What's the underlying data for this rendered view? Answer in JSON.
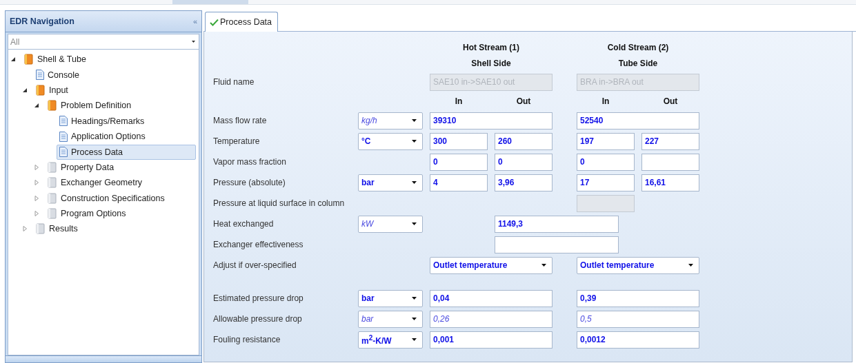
{
  "navigation": {
    "title": "EDR Navigation",
    "collapse_glyph": "«",
    "filter": {
      "value": "All"
    },
    "tree": [
      {
        "label": "Shell & Tube",
        "kind": "group",
        "complete": true,
        "expanded": true,
        "selected": false,
        "children": [
          {
            "label": "Console",
            "kind": "page",
            "selected": false
          },
          {
            "label": "Input",
            "kind": "group",
            "complete": true,
            "expanded": true,
            "selected": false,
            "children": [
              {
                "label": "Problem Definition",
                "kind": "group",
                "complete": true,
                "expanded": true,
                "selected": false,
                "children": [
                  {
                    "label": "Headings/Remarks",
                    "kind": "page",
                    "selected": false
                  },
                  {
                    "label": "Application Options",
                    "kind": "page",
                    "selected": false
                  },
                  {
                    "label": "Process Data",
                    "kind": "page",
                    "selected": true
                  }
                ]
              },
              {
                "label": "Property Data",
                "kind": "group",
                "complete": false,
                "expanded": false,
                "selected": false
              },
              {
                "label": "Exchanger Geometry",
                "kind": "group",
                "complete": false,
                "expanded": false,
                "selected": false
              },
              {
                "label": "Construction Specifications",
                "kind": "group",
                "complete": false,
                "expanded": false,
                "selected": false
              },
              {
                "label": "Program Options",
                "kind": "group",
                "complete": false,
                "expanded": false,
                "selected": false
              }
            ]
          },
          {
            "label": "Results",
            "kind": "group",
            "complete": false,
            "expanded": false,
            "selected": false
          }
        ]
      }
    ]
  },
  "tabs": [
    {
      "label": "Process Data",
      "selected": true,
      "complete": true
    }
  ],
  "form": {
    "stream_titles": {
      "hot": "Hot Stream (1)",
      "cold": "Cold Stream (2)"
    },
    "sides": {
      "hot": "Shell Side",
      "cold": "Tube Side"
    },
    "rows": [
      {
        "kind": "fields",
        "label": "Fluid name",
        "hot": {
          "value": "SAE10 in->SAE10 out",
          "kind": "disabled"
        },
        "cold": {
          "value": "BRA in->BRA out",
          "kind": "disabled"
        }
      },
      {
        "kind": "io",
        "hot_in": "In",
        "hot_out": "Out",
        "cold_in": "In",
        "cold_out": "Out"
      },
      {
        "kind": "fields",
        "label": "Mass flow rate",
        "unit": {
          "value": "kg/h",
          "kind": "default"
        },
        "hot": {
          "value": "39310",
          "kind": "entered"
        },
        "cold": {
          "value": "52540",
          "kind": "entered"
        }
      },
      {
        "kind": "fields",
        "label": "Temperature",
        "unit": {
          "value": "°C",
          "kind": "entered"
        },
        "hot_in": {
          "value": "300",
          "kind": "entered"
        },
        "hot_out": {
          "value": "260",
          "kind": "entered"
        },
        "cold_in": {
          "value": "197",
          "kind": "entered"
        },
        "cold_out": {
          "value": "227",
          "kind": "entered"
        }
      },
      {
        "kind": "fields",
        "label": "Vapor mass fraction",
        "hot_in": {
          "value": "0",
          "kind": "entered"
        },
        "hot_out": {
          "value": "0",
          "kind": "entered"
        },
        "cold_in": {
          "value": "0",
          "kind": "entered"
        },
        "cold_out": {
          "kind": "entered"
        }
      },
      {
        "kind": "fields",
        "label": "Pressure (absolute)",
        "unit": {
          "value": "bar",
          "kind": "entered"
        },
        "hot_in": {
          "value": "4",
          "kind": "entered"
        },
        "hot_out": {
          "value": "3,96",
          "kind": "entered"
        },
        "cold_in": {
          "value": "17",
          "kind": "entered"
        },
        "cold_out": {
          "value": "16,61",
          "kind": "entered"
        }
      },
      {
        "kind": "fields",
        "label": "Pressure at liquid surface in column",
        "cold_in": {
          "kind": "disabled"
        }
      },
      {
        "kind": "fields",
        "label": "Heat exchanged",
        "unit": {
          "value": "kW",
          "kind": "default"
        },
        "overall": {
          "value": "1149,3",
          "kind": "entered"
        }
      },
      {
        "kind": "fields",
        "label": "Exchanger effectiveness",
        "overall": {
          "kind": "entered"
        }
      },
      {
        "kind": "fields",
        "label": "Adjust if over-specified",
        "hot": {
          "value": "Outlet temperature",
          "kind": "entered",
          "dropdown": true
        },
        "cold": {
          "value": "Outlet temperature",
          "kind": "entered",
          "dropdown": true
        }
      },
      {
        "kind": "spacer"
      },
      {
        "kind": "fields",
        "label": "Estimated pressure drop",
        "unit": {
          "value": "bar",
          "kind": "entered"
        },
        "hot": {
          "value": "0,04",
          "kind": "entered"
        },
        "cold": {
          "value": "0,39",
          "kind": "entered"
        }
      },
      {
        "kind": "fields",
        "label": "Allowable pressure drop",
        "unit": {
          "value": "bar",
          "kind": "default"
        },
        "hot": {
          "value": "0,26",
          "kind": "default"
        },
        "cold": {
          "value": "0,5",
          "kind": "default"
        }
      },
      {
        "kind": "fields",
        "label": "Fouling resistance",
        "unit": {
          "value": "m$^{2}$-K/W",
          "kind": "entered"
        },
        "hot": {
          "value": "0,001",
          "kind": "entered"
        },
        "cold": {
          "value": "0,0012",
          "kind": "entered"
        }
      }
    ]
  }
}
